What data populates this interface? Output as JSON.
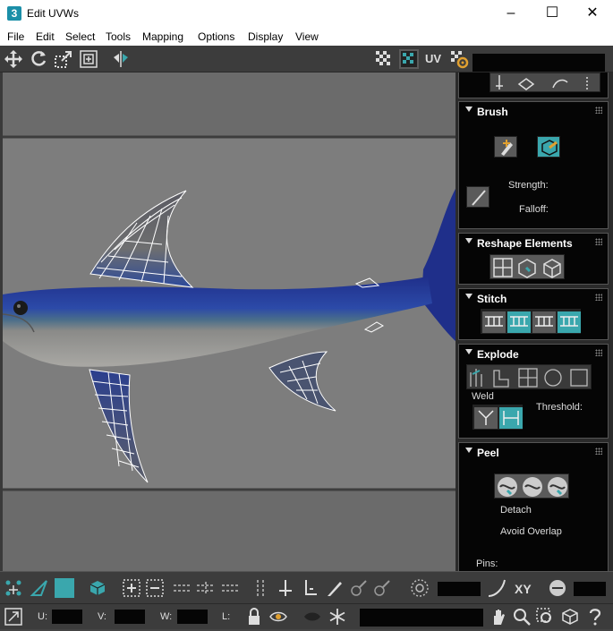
{
  "window": {
    "app_icon_char": "3",
    "title": "Edit UVWs",
    "minimize_glyph": "–",
    "maximize_glyph": "☐",
    "close_glyph": "✕"
  },
  "menubar": [
    "File",
    "Edit",
    "Select",
    "Tools",
    "Mapping",
    "Options",
    "Display",
    "View"
  ],
  "top_toolbar": {
    "uv_label": "UV",
    "icons": [
      "move-icon",
      "rotate-icon",
      "scale-icon",
      "freeform-icon",
      "mirror-icon",
      "checker-icon",
      "checker-texture-icon",
      "uv-toggle-icon",
      "settings-icon"
    ]
  },
  "right_panel": {
    "brush": {
      "title": "Brush",
      "strength_label": "Strength:",
      "falloff_label": "Falloff:"
    },
    "reshape": {
      "title": "Reshape Elements"
    },
    "stitch": {
      "title": "Stitch"
    },
    "explode": {
      "title": "Explode",
      "weld_label": "Weld",
      "threshold_label": "Threshold:"
    },
    "peel": {
      "title": "Peel",
      "detach_label": "Detach",
      "avoid_overlap_label": "Avoid Overlap",
      "pins_label": "Pins:"
    }
  },
  "bottom_bar": {
    "xy_label": "XY",
    "u_label": "U:",
    "v_label": "V:",
    "w_label": "W:",
    "l_label": "L:"
  },
  "colors": {
    "accent_teal": "#3aa7ad",
    "viewport_bg": "#6b6b6b",
    "panel_bg": "#050505"
  }
}
